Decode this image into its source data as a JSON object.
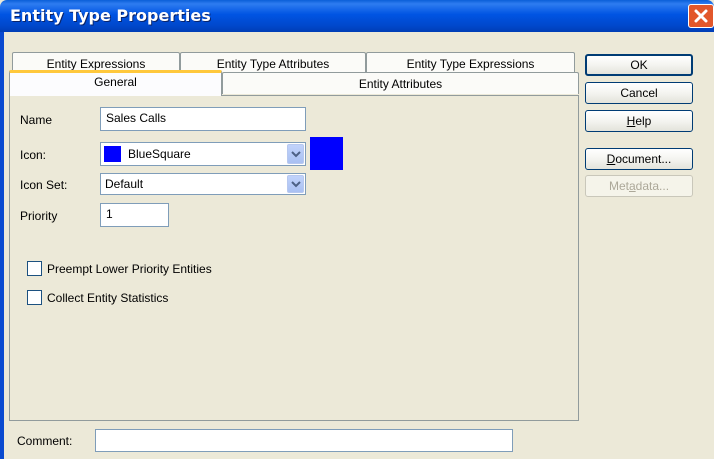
{
  "window": {
    "title": "Entity Type Properties"
  },
  "tabs": {
    "back": [
      "Entity Expressions",
      "Entity Type Attributes",
      "Entity Type Expressions"
    ],
    "front": [
      "General",
      "Entity Attributes"
    ]
  },
  "general": {
    "name_label": "Name",
    "name_value": "Sales Calls",
    "icon_label": "Icon:",
    "icon_value": "BlueSquare",
    "icon_color": "#0000ff",
    "iconset_label": "Icon Set:",
    "iconset_value": "Default",
    "priority_label": "Priority",
    "priority_value": "1",
    "preempt_label": "Preempt Lower Priority Entities",
    "preempt_checked": false,
    "collect_label": "Collect Entity Statistics",
    "collect_checked": false
  },
  "comment": {
    "label": "Comment:",
    "value": ""
  },
  "buttons": {
    "ok": "OK",
    "cancel": "Cancel",
    "help_mnemonic": "H",
    "help_rest": "elp",
    "document_mnemonic": "D",
    "document_rest": "ocument...",
    "metadata_pre": "Met",
    "metadata_mnemonic": "a",
    "metadata_rest": "data..."
  }
}
